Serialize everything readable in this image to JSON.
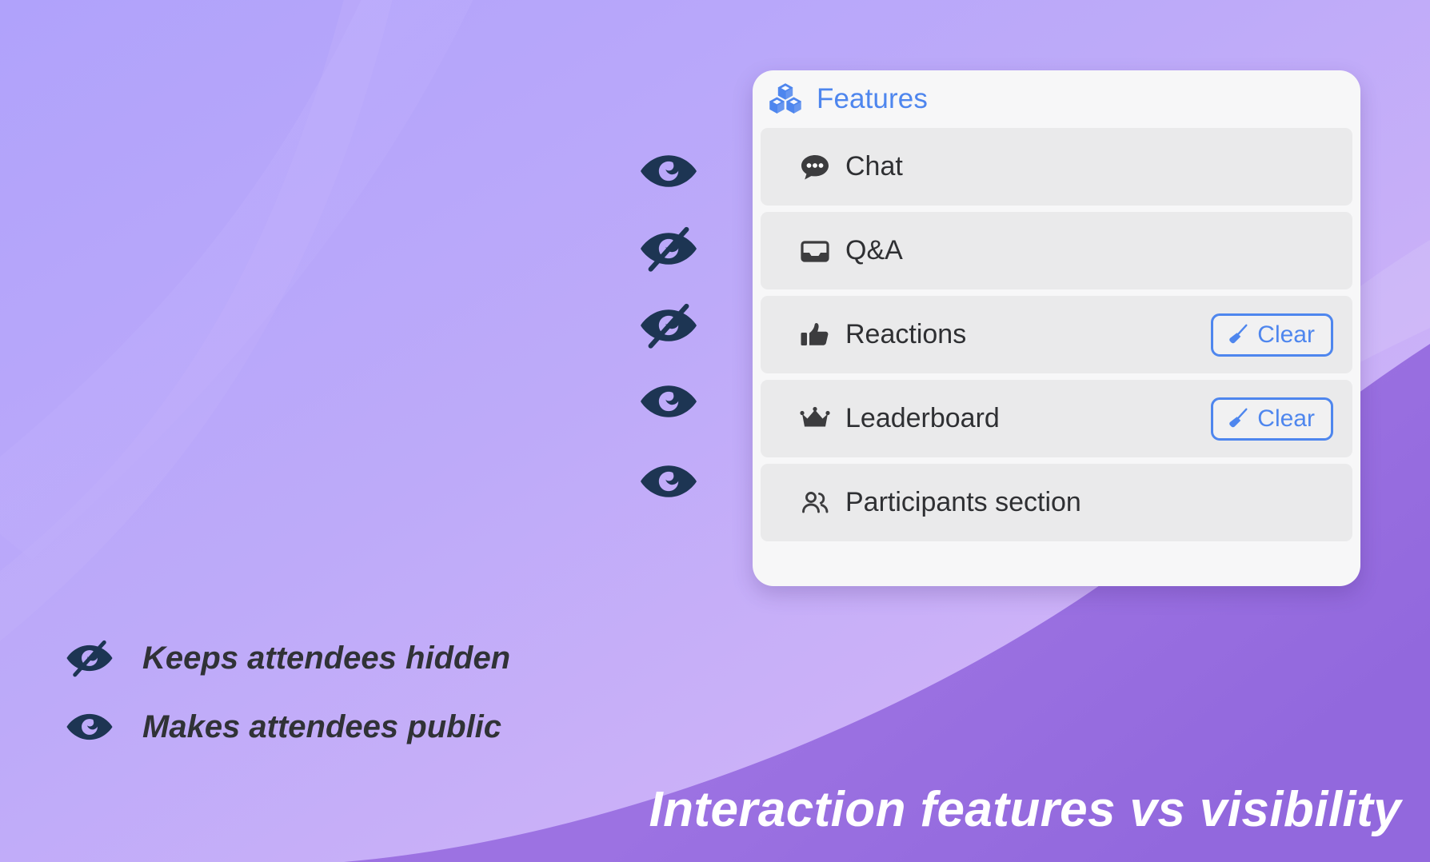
{
  "background": {
    "gradient_from": "#b3a4fb",
    "gradient_to": "#d3b3f7",
    "wave_color": "#9b6fe0"
  },
  "card": {
    "header": {
      "icon": "cubes-icon",
      "title": "Features",
      "title_color": "#4e86ee"
    },
    "rows": [
      {
        "icon": "chat-bubble-icon",
        "label": "Chat",
        "visibility": "visible",
        "visibility_icon": "eye-icon",
        "has_clear": false,
        "clear_label": ""
      },
      {
        "icon": "inbox-tray-icon",
        "label": "Q&A",
        "visibility": "hidden",
        "visibility_icon": "eye-off-icon",
        "has_clear": false,
        "clear_label": ""
      },
      {
        "icon": "thumbs-up-icon",
        "label": "Reactions",
        "visibility": "hidden",
        "visibility_icon": "eye-off-icon",
        "has_clear": true,
        "clear_label": "Clear"
      },
      {
        "icon": "crown-icon",
        "label": "Leaderboard",
        "visibility": "visible",
        "visibility_icon": "eye-icon",
        "has_clear": true,
        "clear_label": "Clear"
      },
      {
        "icon": "people-icon",
        "label": "Participants section",
        "visibility": "visible",
        "visibility_icon": "eye-icon",
        "has_clear": false,
        "clear_label": ""
      }
    ]
  },
  "legend": {
    "items": [
      {
        "icon": "eye-off-icon",
        "text": "Keeps attendees hidden"
      },
      {
        "icon": "eye-icon",
        "text": "Makes attendees public"
      }
    ]
  },
  "caption": {
    "text": "Interaction features vs visibility",
    "color": "#ffffff"
  },
  "colors": {
    "accent_blue": "#4e86ee",
    "eye_navy": "#1d3553",
    "row_bg": "#eaeaeb",
    "card_bg": "#f7f7f8",
    "label_gray": "#2f3033"
  }
}
